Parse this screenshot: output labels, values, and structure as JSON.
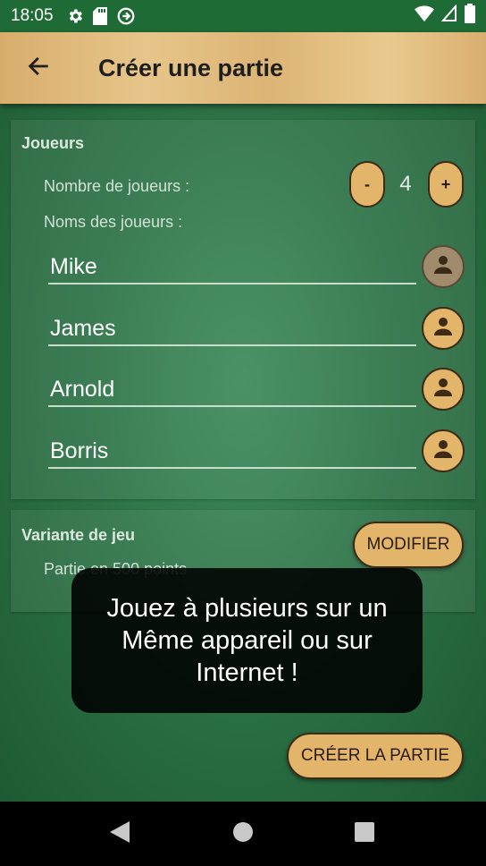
{
  "status_bar": {
    "time": "18:05",
    "icons": [
      "gear-icon",
      "sd-card-icon",
      "vpn-key-icon",
      "wifi-icon",
      "no-sim-icon",
      "battery-icon"
    ]
  },
  "app_bar": {
    "title": "Créer une partie",
    "back_icon": "arrow-back-icon"
  },
  "players_section": {
    "title": "Joueurs",
    "count_label": "Nombre de joueurs :",
    "decrement_label": "-",
    "count_value": "4",
    "increment_label": "+",
    "names_label": "Noms des joueurs :",
    "players": [
      {
        "name": "Mike",
        "avatar_icon": "person-icon"
      },
      {
        "name": "James",
        "avatar_icon": "person-icon"
      },
      {
        "name": "Arnold",
        "avatar_icon": "person-icon"
      },
      {
        "name": "Borris",
        "avatar_icon": "person-icon"
      }
    ]
  },
  "variant_section": {
    "title": "Variante de jeu",
    "modify_label": "MODIFIER",
    "description": "Partie en 500 points"
  },
  "toast": {
    "message": "Jouez à plusieurs sur un Même appareil ou sur Internet !"
  },
  "create_button_label": "CRÉER LA PARTIE",
  "nav_bar": {
    "icons": [
      "back-triangle-icon",
      "home-circle-icon",
      "recents-square-icon"
    ]
  },
  "colors": {
    "status_bar": "#1f6b35",
    "accent_button": "#e3b56a",
    "button_border": "#3d2a14",
    "table_green": "#2d7347"
  }
}
